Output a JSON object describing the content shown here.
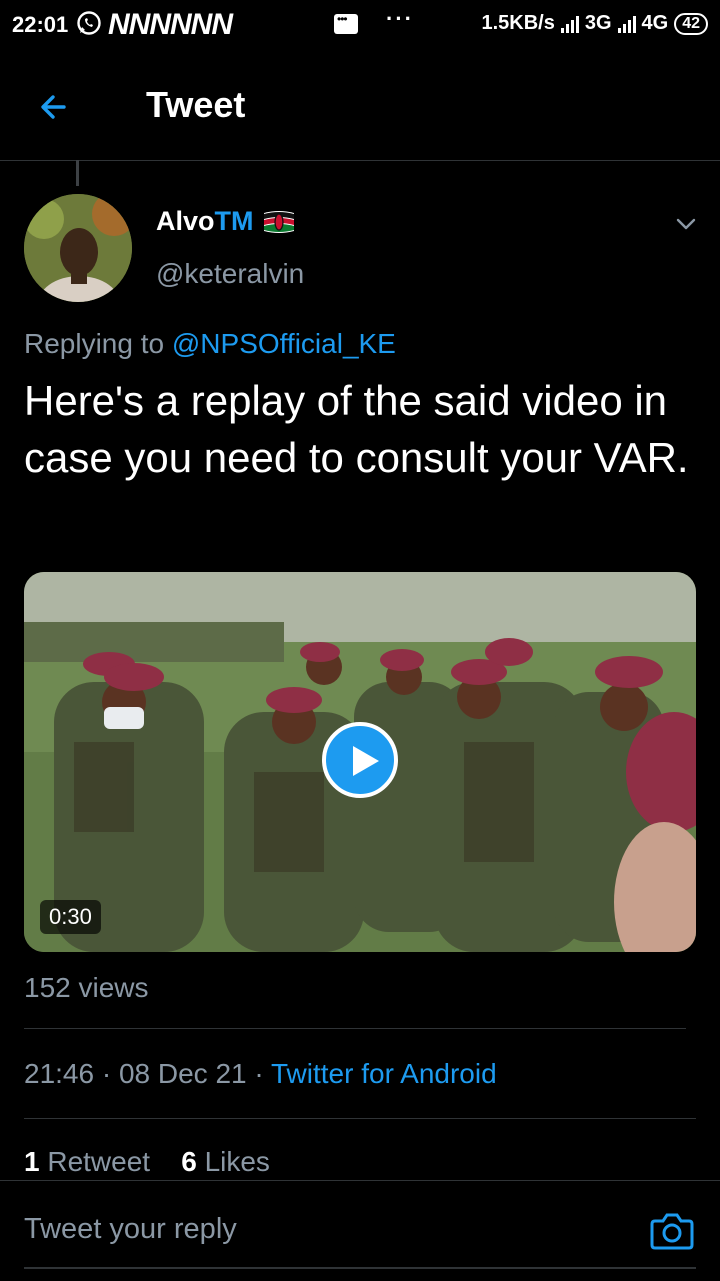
{
  "status_bar": {
    "time": "22:01",
    "notif_letters": "NNNNNN",
    "more": "···",
    "net_speed": "1.5KB/s",
    "net1": "3G",
    "net2": "4G",
    "battery": "42"
  },
  "header": {
    "title": "Tweet",
    "back_icon": "arrow-left-icon"
  },
  "author": {
    "name": "Alvo",
    "name_accent": "TM",
    "handle": "@keteralvin",
    "flag_icon": "kenya-flag-icon"
  },
  "tweet": {
    "replying_prefix": "Replying to",
    "replying_to": "@NPSOfficial_KE",
    "text": "Here's a replay of the said video in case you need to consult your VAR.",
    "media_duration": "0:30",
    "views": "152 views",
    "time": "21:46",
    "sep1": "·",
    "date": "08 Dec 21",
    "sep2": "·",
    "source": "Twitter for Android",
    "retweets_count": "1",
    "retweets_label": "Retweet",
    "likes_count": "6",
    "likes_label": "Likes"
  },
  "reply": {
    "placeholder": "Tweet your reply",
    "camera_icon": "camera-icon"
  },
  "colors": {
    "accent": "#1d9bf0",
    "secondary_text": "#8b98a5",
    "divider": "#2f3336"
  }
}
